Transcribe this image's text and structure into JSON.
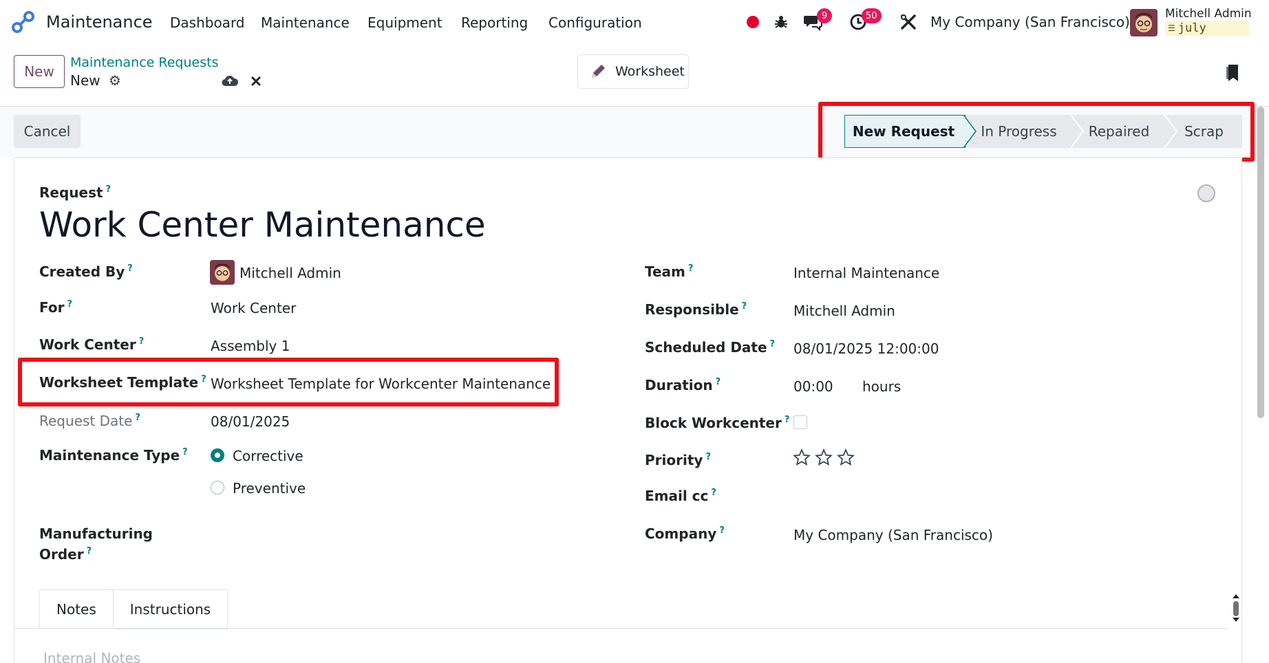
{
  "navbar": {
    "app_name": "Maintenance",
    "menu": [
      "Dashboard",
      "Maintenance",
      "Equipment",
      "Reporting",
      "Configuration"
    ],
    "messages_count": "9",
    "activities_count": "50",
    "company": "My Company (San Francisco)",
    "user_name": "Mitchell Admin",
    "db_name": "july"
  },
  "control_panel": {
    "new_label": "New",
    "breadcrumb_parent": "Maintenance Requests",
    "breadcrumb_current": "New",
    "worksheet_label": "Worksheet"
  },
  "status": {
    "cancel_label": "Cancel",
    "stages": [
      "New Request",
      "In Progress",
      "Repaired",
      "Scrap"
    ],
    "active_stage": "New Request"
  },
  "form": {
    "request_label": "Request",
    "title": "Work Center Maintenance",
    "left": {
      "created_by_label": "Created By",
      "created_by_value": "Mitchell Admin",
      "for_label": "For",
      "for_value": "Work Center",
      "work_center_label": "Work Center",
      "work_center_value": "Assembly 1",
      "worksheet_template_label": "Worksheet Template",
      "worksheet_template_value": "Worksheet Template for Workcenter Maintenance",
      "request_date_label": "Request Date",
      "request_date_value": "08/01/2025",
      "maintenance_type_label": "Maintenance Type",
      "maintenance_type_options": [
        "Corrective",
        "Preventive"
      ],
      "maintenance_type_selected": "Corrective",
      "manufacturing_order_label_1": "Manufacturing",
      "manufacturing_order_label_2": "Order"
    },
    "right": {
      "team_label": "Team",
      "team_value": "Internal Maintenance",
      "responsible_label": "Responsible",
      "responsible_value": "Mitchell Admin",
      "scheduled_date_label": "Scheduled Date",
      "scheduled_date_value": "08/01/2025 12:00:00",
      "duration_label": "Duration",
      "duration_value": "00:00",
      "duration_unit": "hours",
      "block_workcenter_label": "Block Workcenter",
      "priority_label": "Priority",
      "priority_stars": 3,
      "priority_value": 0,
      "email_cc_label": "Email cc",
      "company_label": "Company",
      "company_value": "My Company (San Francisco)"
    },
    "tabs": [
      "Notes",
      "Instructions"
    ],
    "notes_placeholder": "Internal Notes",
    "help_mark": "?"
  },
  "colors": {
    "brand": "#714b67",
    "accent": "#017e84",
    "highlight": "#ee0e17",
    "badge": "#e8175d"
  }
}
